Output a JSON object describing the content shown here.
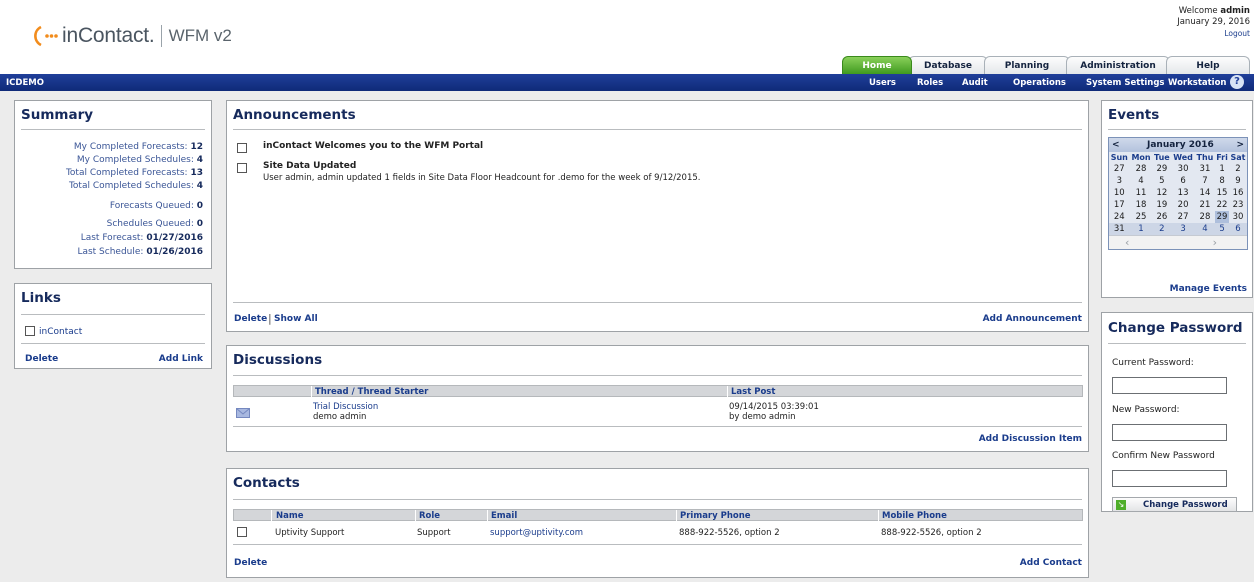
{
  "header": {
    "brand": "inContact.",
    "product": "WFM v2",
    "welcome_prefix": "Welcome ",
    "welcome_user": "admin",
    "date": "January 29, 2016",
    "logout": "Logout"
  },
  "tabs": [
    {
      "label": "Home",
      "active": true
    },
    {
      "label": "Database",
      "active": false
    },
    {
      "label": "Planning",
      "active": false
    },
    {
      "label": "Administration",
      "active": false
    },
    {
      "label": "Help",
      "active": false
    }
  ],
  "navbar": {
    "site": "ICDEMO",
    "items": [
      "Users",
      "Roles",
      "Audit",
      "Operations",
      "System Settings",
      "Workstation"
    ]
  },
  "summary": {
    "title": "Summary",
    "rows": [
      {
        "label": "My Completed Forecasts:",
        "value": "12"
      },
      {
        "label": "My Completed Schedules:",
        "value": "4"
      },
      {
        "label": "Total Completed Forecasts:",
        "value": "13"
      },
      {
        "label": "Total Completed Schedules:",
        "value": "4"
      },
      {
        "label": "Forecasts Queued:",
        "value": "0"
      },
      {
        "label": "Schedules Queued:",
        "value": "0"
      },
      {
        "label": "Last Forecast:",
        "value": "01/27/2016"
      },
      {
        "label": "Last Schedule:",
        "value": "01/26/2016"
      }
    ]
  },
  "links": {
    "title": "Links",
    "items": [
      "inContact"
    ],
    "delete": "Delete",
    "add": "Add Link"
  },
  "announcements": {
    "title": "Announcements",
    "items": [
      {
        "title": "inContact Welcomes you to the WFM Portal",
        "body": ""
      },
      {
        "title": "Site Data Updated",
        "body": "User admin, admin updated 1 fields in Site Data Floor Headcount for .demo for the week of 9/12/2015."
      }
    ],
    "delete": "Delete",
    "show_all": "Show All",
    "add": "Add Announcement"
  },
  "discussions": {
    "title": "Discussions",
    "columns": [
      "Thread / Thread Starter",
      "Last Post"
    ],
    "rows": [
      {
        "thread": "Trial Discussion",
        "starter": "demo admin",
        "last_post": "09/14/2015 03:39:01",
        "by": "by demo admin"
      }
    ],
    "add": "Add Discussion Item"
  },
  "contacts": {
    "title": "Contacts",
    "columns": [
      "Name",
      "Role",
      "Email",
      "Primary Phone",
      "Mobile Phone"
    ],
    "rows": [
      {
        "name": "Uptivity Support",
        "role": "Support",
        "email": "support@uptivity.com",
        "primary": "888-922-5526, option 2",
        "mobile": "888-922-5526, option 2"
      }
    ],
    "delete": "Delete",
    "add": "Add Contact"
  },
  "events": {
    "title": "Events",
    "month": "January 2016",
    "prev": "<",
    "next": ">",
    "weekdays": [
      "Sun",
      "Mon",
      "Tue",
      "Wed",
      "Thu",
      "Fri",
      "Sat"
    ],
    "weeks": [
      [
        "27",
        "28",
        "29",
        "30",
        "31",
        "1",
        "2"
      ],
      [
        "3",
        "4",
        "5",
        "6",
        "7",
        "8",
        "9"
      ],
      [
        "10",
        "11",
        "12",
        "13",
        "14",
        "15",
        "16"
      ],
      [
        "17",
        "18",
        "19",
        "20",
        "21",
        "22",
        "23"
      ],
      [
        "24",
        "25",
        "26",
        "27",
        "28",
        "29",
        "30"
      ],
      [
        "31",
        "1",
        "2",
        "3",
        "4",
        "5",
        "6"
      ]
    ],
    "selected": "29",
    "manage": "Manage Events"
  },
  "change_password": {
    "title": "Change Password",
    "current": "Current Password:",
    "new": "New Password:",
    "confirm": "Confirm New Password",
    "button": "Change Password"
  },
  "colors": {
    "nav_blue": "#14337f",
    "active_tab_green": "#4fae2a",
    "link_blue": "#1a3c8c"
  }
}
